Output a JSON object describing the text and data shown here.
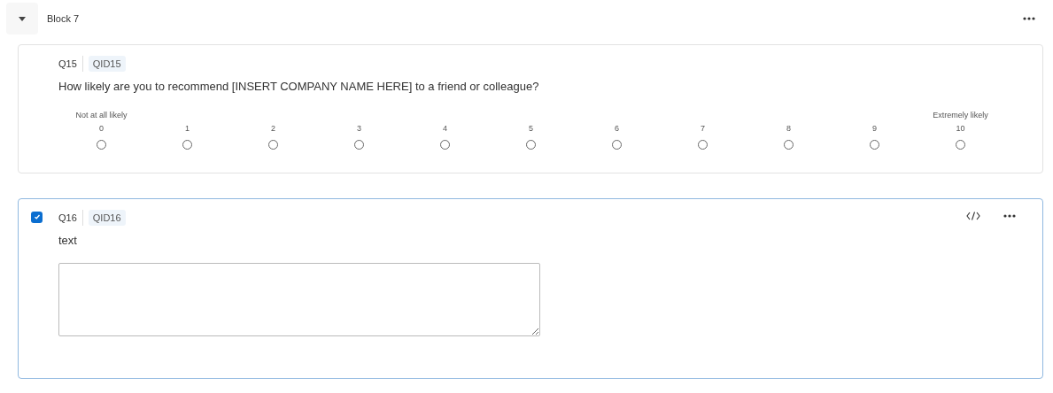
{
  "block": {
    "title": "Block 7",
    "expanded": true
  },
  "questions": [
    {
      "kind": "nps",
      "number": "Q15",
      "id": "QID15",
      "selected": false,
      "text": "How likely are you to recommend [INSERT COMPANY NAME HERE] to a friend or colleague?",
      "low_label": "Not at all likely",
      "high_label": "Extremely likely",
      "options": [
        {
          "label": "0",
          "selected": false
        },
        {
          "label": "1",
          "selected": false
        },
        {
          "label": "2",
          "selected": false
        },
        {
          "label": "3",
          "selected": false
        },
        {
          "label": "4",
          "selected": false
        },
        {
          "label": "5",
          "selected": false
        },
        {
          "label": "6",
          "selected": false
        },
        {
          "label": "7",
          "selected": false
        },
        {
          "label": "8",
          "selected": false
        },
        {
          "label": "9",
          "selected": false
        },
        {
          "label": "10",
          "selected": false
        }
      ]
    },
    {
      "kind": "text_entry",
      "number": "Q16",
      "id": "QID16",
      "selected": true,
      "text": "text"
    }
  ]
}
